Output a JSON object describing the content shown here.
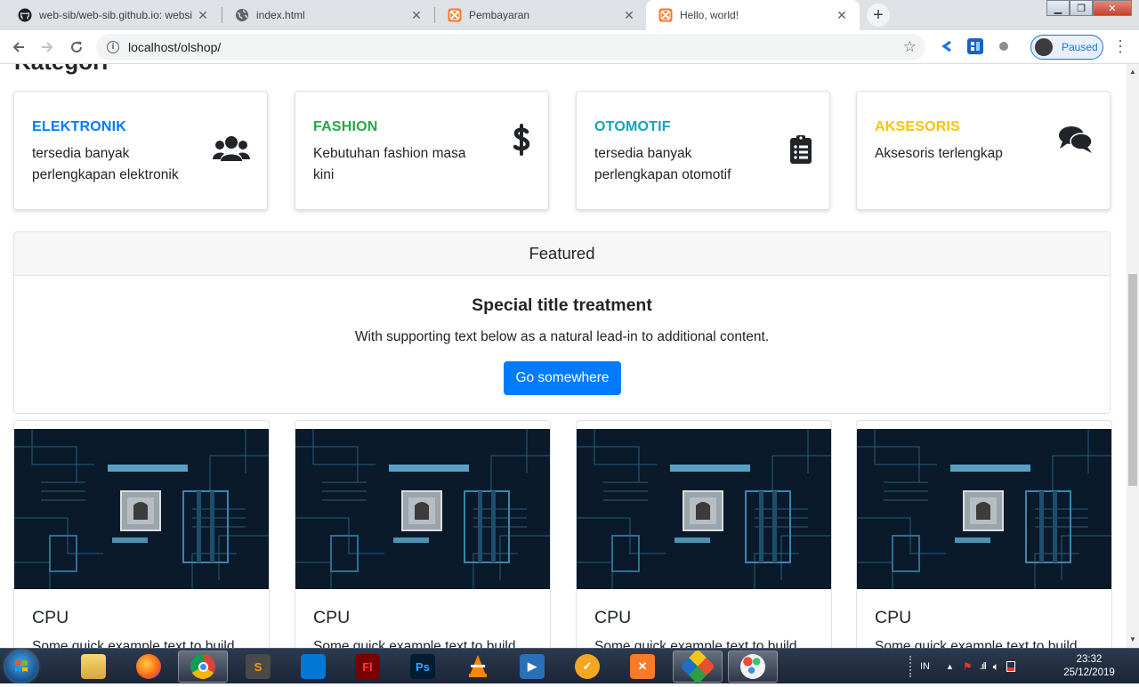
{
  "browser": {
    "tabs": [
      {
        "title": "web-sib/web-sib.github.io: websi",
        "icon": "github-icon"
      },
      {
        "title": "index.html",
        "icon": "globe-icon"
      },
      {
        "title": "Pembayaran",
        "icon": "xampp-icon"
      },
      {
        "title": "Hello, world!",
        "icon": "xampp-icon",
        "active": true
      }
    ],
    "url": "localhost/olshop/",
    "profile_label": "Paused"
  },
  "page": {
    "section_heading": "Kategori",
    "categories": [
      {
        "title": "ELEKTRONIK",
        "text": "tersedia banyak perlengkapan elektronik",
        "color": "#007bff",
        "icon": "users-icon"
      },
      {
        "title": "FASHION",
        "text": "Kebutuhan fashion masa kini",
        "color": "#28a745",
        "icon": "dollar-icon"
      },
      {
        "title": "OTOMOTIF",
        "text": "tersedia banyak perlengkapan otomotif",
        "color": "#17a2b8",
        "icon": "clipboard-list-icon"
      },
      {
        "title": "AKSESORIS",
        "text": "Aksesoris terlengkap",
        "color": "#ffc107",
        "icon": "comments-icon"
      }
    ],
    "featured": {
      "header": "Featured",
      "title": "Special title treatment",
      "text": "With supporting text below as a natural lead-in to additional content.",
      "button": "Go somewhere",
      "button_color": "#007bff"
    },
    "products": [
      {
        "title": "CPU",
        "text": "Some quick example text to build"
      },
      {
        "title": "CPU",
        "text": "Some quick example text to build"
      },
      {
        "title": "CPU",
        "text": "Some quick example text to build"
      },
      {
        "title": "CPU",
        "text": "Some quick example text to build"
      }
    ]
  },
  "taskbar": {
    "apps": [
      "explorer-icon",
      "firefox-icon",
      "chrome-icon",
      "sublime-icon",
      "vscode-icon",
      "flash-icon",
      "photoshop-icon",
      "vlc-icon",
      "media-player-icon",
      "avast-icon",
      "xampp-icon",
      "git-icon",
      "paint-icon"
    ],
    "apps_labels": {
      "flash": "Fl",
      "photoshop": "Ps"
    },
    "language": "IN",
    "time": "23:32",
    "date": "25/12/2019"
  }
}
